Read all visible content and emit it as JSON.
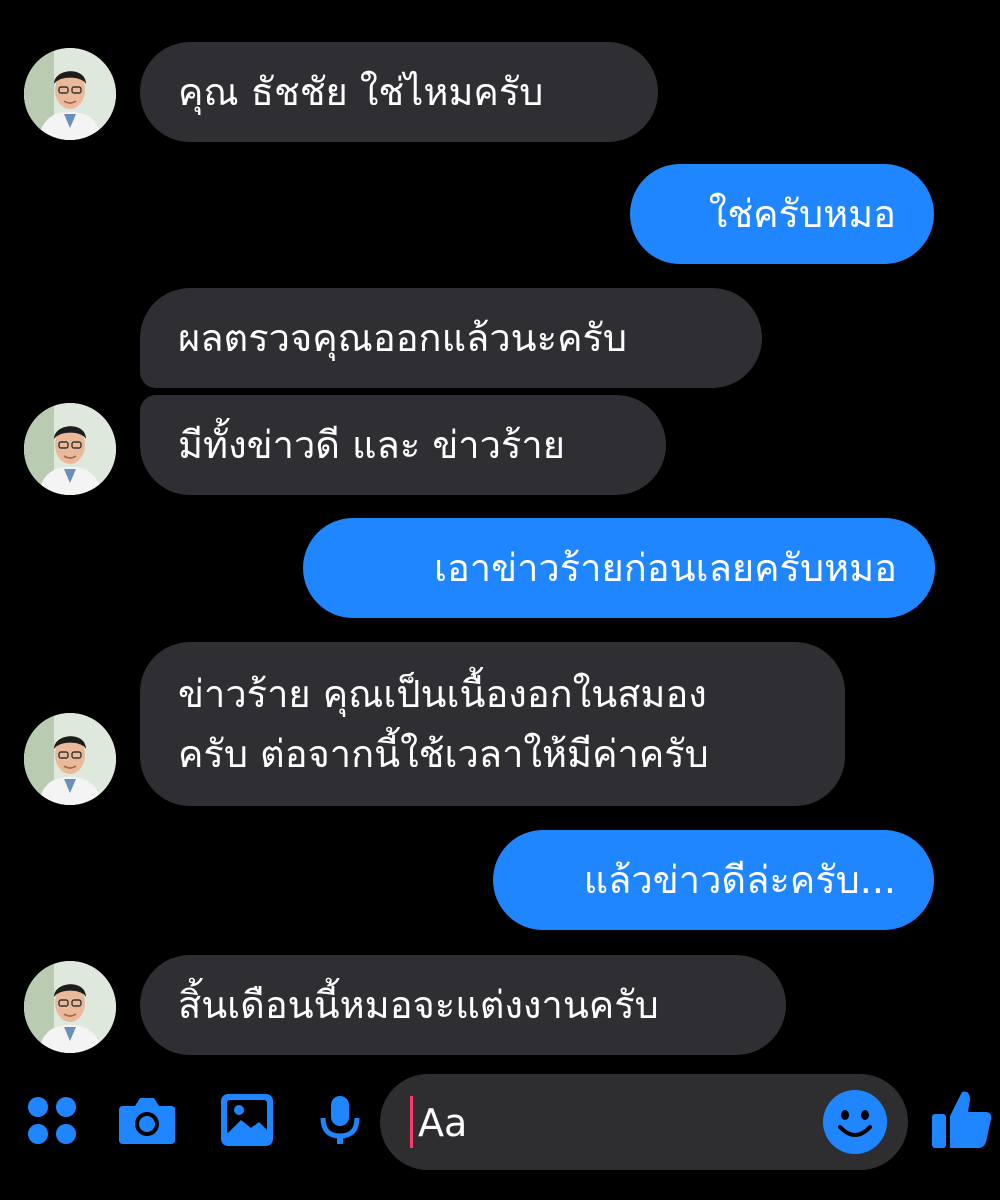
{
  "colors": {
    "background": "#000000",
    "incoming_bubble": "#2f2f33",
    "outgoing_bubble": "#1f86ff",
    "accent": "#1f86ff",
    "text": "#ffffff",
    "composer": "#2e2e31"
  },
  "messages": [
    {
      "sender": "doctor",
      "lines": [
        "คุณ ธัชชัย ใช่ไหมครับ"
      ]
    },
    {
      "sender": "me",
      "lines": [
        "ใช่ครับหมอ"
      ]
    },
    {
      "sender": "doctor",
      "lines": [
        "ผลตรวจคุณออกแล้วนะครับ"
      ]
    },
    {
      "sender": "doctor",
      "lines": [
        "มีทั้งข่าวดี และ ข่าวร้าย"
      ]
    },
    {
      "sender": "me",
      "lines": [
        "เอาข่าวร้ายก่อนเลยครับหมอ"
      ]
    },
    {
      "sender": "doctor",
      "lines": [
        "ข่าวร้าย คุณเป็นเนื้องอกในสมอง",
        "ครับ ต่อจากนี้ใช้เวลาให้มีค่าครับ"
      ]
    },
    {
      "sender": "me",
      "lines": [
        "แล้วข่าวดีล่ะครับ..."
      ]
    },
    {
      "sender": "doctor",
      "lines": [
        "สิ้นเดือนนี้หมอจะแต่งงานครับ"
      ]
    }
  ],
  "composer": {
    "placeholder": "Aa",
    "icons": [
      "apps-icon",
      "camera-icon",
      "gallery-icon",
      "mic-icon",
      "emoji-icon",
      "thumbs-up-icon"
    ]
  }
}
